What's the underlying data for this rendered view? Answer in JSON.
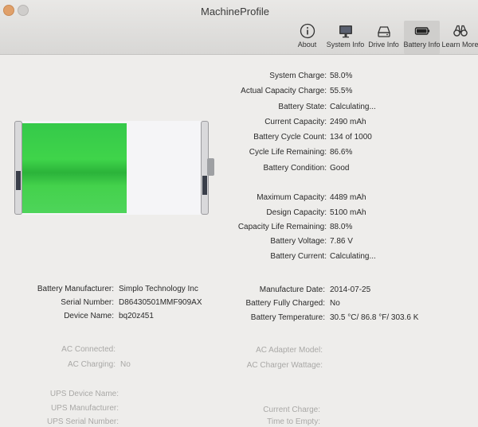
{
  "window": {
    "title": "MachineProfile"
  },
  "toolbar": {
    "items": [
      {
        "label": "About",
        "icon": "info-icon"
      },
      {
        "label": "System Info",
        "icon": "monitor-icon"
      },
      {
        "label": "Drive Info",
        "icon": "drive-icon"
      },
      {
        "label": "Battery Info",
        "icon": "battery-icon",
        "selected": true
      },
      {
        "label": "Learn More",
        "icon": "binoculars-icon"
      }
    ]
  },
  "battery_graphic": {
    "charge_fraction": 0.58,
    "fill_color": "#3fd44a"
  },
  "status": [
    {
      "label": "System Charge:",
      "value": "58.0%"
    },
    {
      "label": "Actual Capacity Charge:",
      "value": "55.5%"
    },
    {
      "label": "Battery State:",
      "value": "Calculating..."
    },
    {
      "label": "Current Capacity:",
      "value": "2490 mAh"
    },
    {
      "label": "Battery Cycle Count:",
      "value": "134 of 1000"
    },
    {
      "label": "Cycle Life Remaining:",
      "value": "86.6%"
    },
    {
      "label": "Battery Condition:",
      "value": "Good"
    }
  ],
  "capacity": [
    {
      "label": "Maximum Capacity:",
      "value": "4489 mAh"
    },
    {
      "label": "Design Capacity:",
      "value": "5100 mAh"
    },
    {
      "label": "Capacity Life Remaining:",
      "value": "88.0%"
    },
    {
      "label": "Battery Voltage:",
      "value": "7.86 V"
    },
    {
      "label": "Battery Current:",
      "value": "Calculating..."
    }
  ],
  "details_left": [
    {
      "label": "Battery Manufacturer:",
      "value": "Simplo Technology Inc"
    },
    {
      "label": "Serial Number:",
      "value": "D86430501MMF909AX"
    },
    {
      "label": "Device Name:",
      "value": "bq20z451"
    }
  ],
  "details_right": [
    {
      "label": "Manufacture Date:",
      "value": "2014-07-25"
    },
    {
      "label": "Battery Fully Charged:",
      "value": "No"
    },
    {
      "label": "Battery Temperature:",
      "value": "30.5 °C/ 86.8 °F/ 303.6 K"
    }
  ],
  "ac_left": [
    {
      "label": "AC Connected:",
      "value": ""
    },
    {
      "label": "AC Charging:",
      "value": "No"
    }
  ],
  "ac_right": [
    {
      "label": "AC Adapter Model:",
      "value": ""
    },
    {
      "label": "AC Charger Wattage:",
      "value": ""
    }
  ],
  "ups_left": [
    {
      "label": "UPS Device Name:",
      "value": ""
    },
    {
      "label": "UPS Manufacturer:",
      "value": ""
    },
    {
      "label": "UPS Serial Number:",
      "value": ""
    }
  ],
  "ups_right": [
    {
      "label": "Current Charge:",
      "value": ""
    },
    {
      "label": "Time to Empty:",
      "value": ""
    }
  ]
}
